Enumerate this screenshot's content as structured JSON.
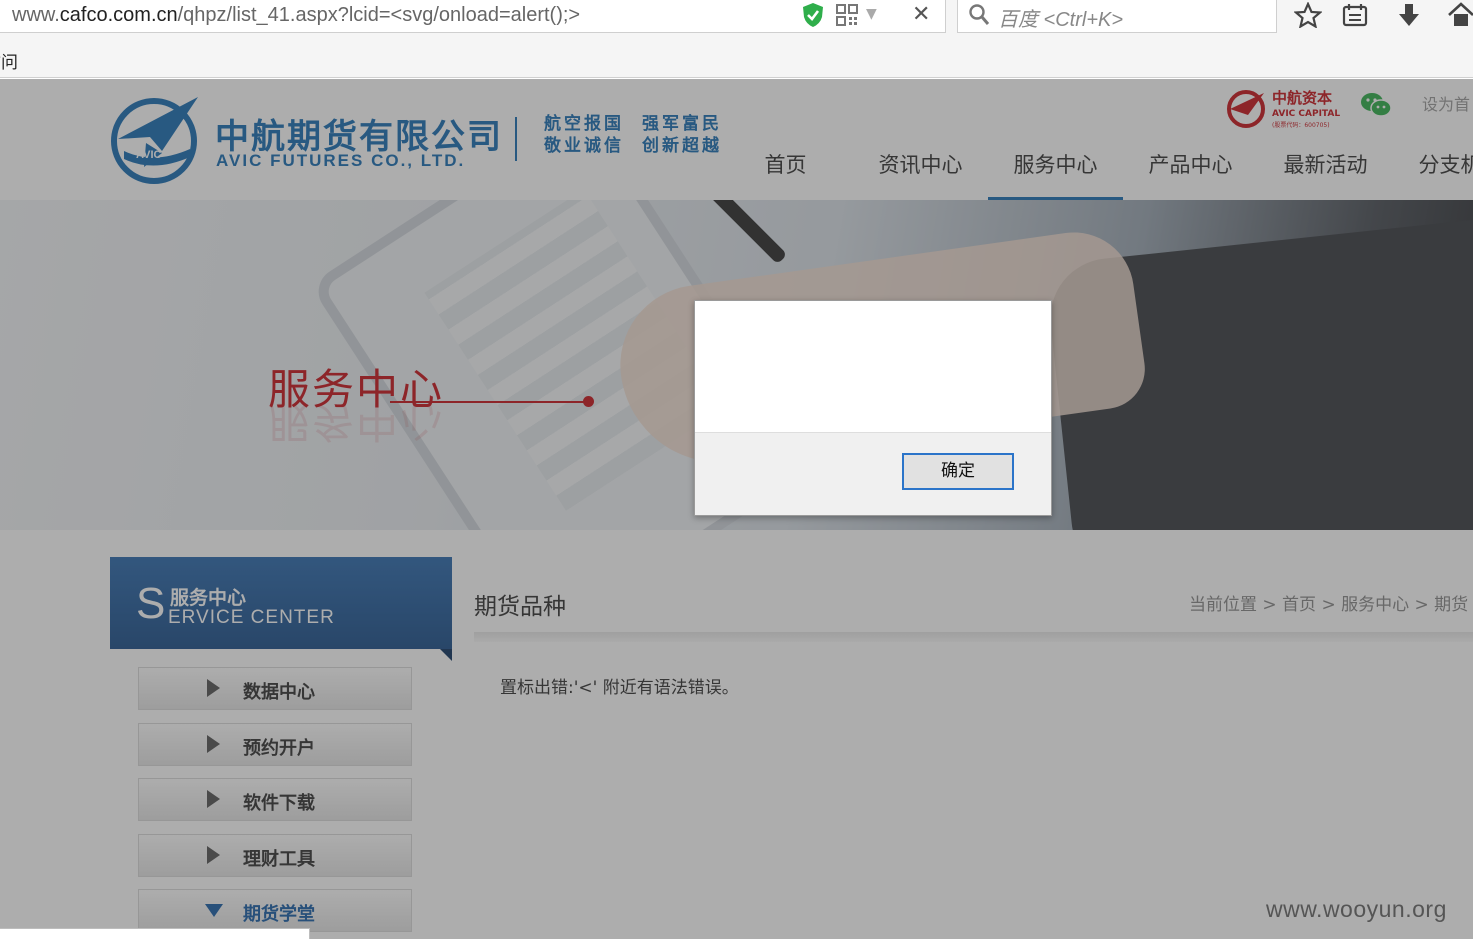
{
  "browser": {
    "url_prefix": "www.",
    "url_domain": "cafco.com.cn",
    "url_rest": "/qhpz/list_41.aspx?lcid=<svg/onload=alert();>",
    "search_placeholder": "百度 <Ctrl+K>",
    "bookmark_fragment": "访问"
  },
  "header": {
    "company_cn": "中航期货有限公司",
    "company_en": "AVIC FUTURES CO., LTD.",
    "slogan_line1_a": "航空报国",
    "slogan_line1_b": "强军富民",
    "slogan_line2_a": "敬业诚信",
    "slogan_line2_b": "创新超越",
    "logo_text": "AVIC",
    "capital_cn": "中航资本",
    "capital_en": "AVIC CAPITAL",
    "capital_code": "(股票代码：600705)",
    "set_home": "设为首"
  },
  "nav": {
    "items": [
      "首页",
      "资讯中心",
      "服务中心",
      "产品中心",
      "最新活动",
      "分支机构"
    ],
    "active_index": 2
  },
  "banner": {
    "title": "服务中心"
  },
  "sidebar": {
    "head_s": "S",
    "head_cn": "服务中心",
    "head_en": "ERVICE CENTER",
    "items": [
      {
        "label": "数据中心"
      },
      {
        "label": "预约开户"
      },
      {
        "label": "软件下载"
      },
      {
        "label": "理财工具"
      },
      {
        "label": "期货学堂"
      }
    ]
  },
  "main": {
    "title": "期货品种",
    "breadcrumb": "当前位置 > 首页 > 服务中心 > 期货",
    "error_text": "置标出错:'<' 附近有语法错误。"
  },
  "dialog": {
    "message": "",
    "ok_label": "确定"
  },
  "watermark": "www.wooyun.org",
  "colors": {
    "brand_blue": "#1a6fb4",
    "brand_red": "#c8161d"
  }
}
